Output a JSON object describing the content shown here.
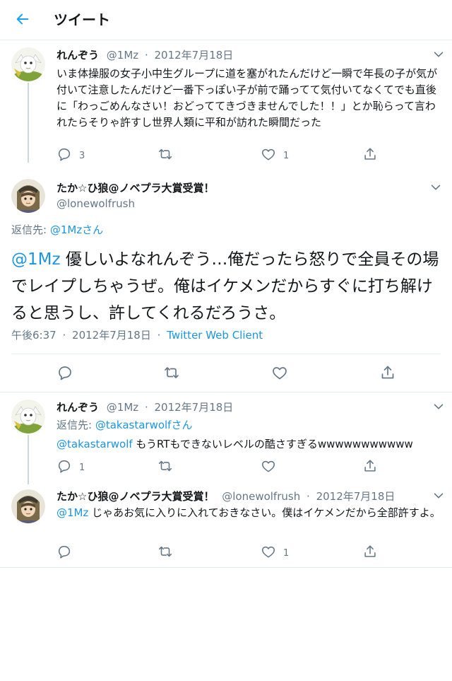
{
  "header": {
    "title": "ツイート",
    "back_icon": "arrow-left-icon"
  },
  "colors": {
    "accent": "#1da1f2",
    "link": "#1b95e0",
    "muted": "#657786",
    "text": "#14171a",
    "border": "#e6ecf0"
  },
  "tweet1": {
    "name": "れんぞう",
    "handle": "@1Mz",
    "dot": "·",
    "date": "2012年7月18日",
    "text": "いま体操服の女子小中生グループに道を塞がれたんだけど一瞬で年長の子が気が付いて注意したんだけど一番下っぽい子が前で踊ってて気付いてなくてでも直後に「わっごめんなさい！おどっててきづきませんでした！！」とか恥らって言われたらそりゃ許すし世界人類に平和が訪れた瞬間だった",
    "reply_count": "3",
    "retweet_count": "",
    "like_count": "1"
  },
  "focus": {
    "name": "たか☆ひ狼@ノベプラ大賞受賞！",
    "handle": "@lonewolfrush",
    "reply_prefix": "返信先: ",
    "reply_mention": "@1Mzさん",
    "mention": "@1Mz",
    "text": " 優しいよなれんぞう…俺だったら怒りで全員その場でレイプしちゃうぜ。俺はイケメンだからすぐに打ち解けると思うし、許してくれるだろうさ。",
    "time": "午後6:37",
    "dot": "·",
    "date": "2012年7月18日",
    "client": "Twitter Web Client"
  },
  "reply1": {
    "name": "れんぞう",
    "handle": "@1Mz",
    "dot": "·",
    "date": "2012年7月18日",
    "reply_prefix": "返信先: ",
    "reply_mention": "@takastarwolfさん",
    "mention": "@takastarwolf",
    "text": " もうRTもできないレベルの酷さすぎるwwwwwwwwwww",
    "reply_count": "1",
    "retweet_count": "",
    "like_count": ""
  },
  "reply2": {
    "name": "たか☆ひ狼@ノベプラ大賞受賞！",
    "handle": "@lonewolfrush",
    "dot": "·",
    "date": "2012年7月18日",
    "mention": "@1Mz",
    "text": " じゃあお気に入りに入れておきなさい。僕はイケメンだから全部許すよ。",
    "reply_count": "",
    "retweet_count": "",
    "like_count": "1"
  }
}
